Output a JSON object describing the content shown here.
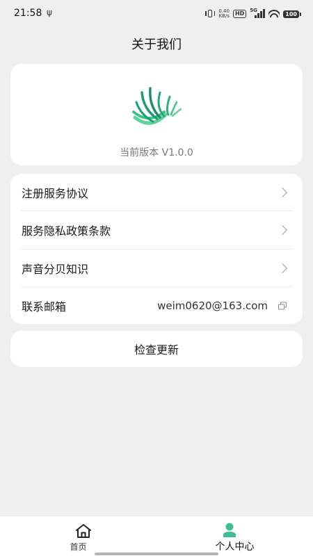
{
  "status_bar": {
    "time": "21:58",
    "usb_symbol": "ψ",
    "net_speed_value": "0.40",
    "net_speed_unit": "KB/s",
    "hd": "HD",
    "network_type": "5G",
    "battery": "100"
  },
  "page": {
    "title": "关于我们"
  },
  "about": {
    "logo_icon": "app-logo",
    "version": "当前版本 V1.0.0",
    "accent_color": "#1fb57a"
  },
  "menu": {
    "items": [
      {
        "label": "注册服务协议",
        "icon": "chevron-right-icon"
      },
      {
        "label": "服务隐私政策条款",
        "icon": "chevron-right-icon"
      },
      {
        "label": "声音分贝知识",
        "icon": "chevron-right-icon"
      },
      {
        "label": "联系邮箱",
        "value": "weim0620@163.com",
        "icon": "copy-icon"
      }
    ]
  },
  "update": {
    "label": "检查更新"
  },
  "tabs": [
    {
      "label": "首页",
      "icon": "home-icon",
      "active": false
    },
    {
      "label": "个人中心",
      "icon": "person-icon",
      "active": true,
      "color": "#3dc08f"
    }
  ]
}
